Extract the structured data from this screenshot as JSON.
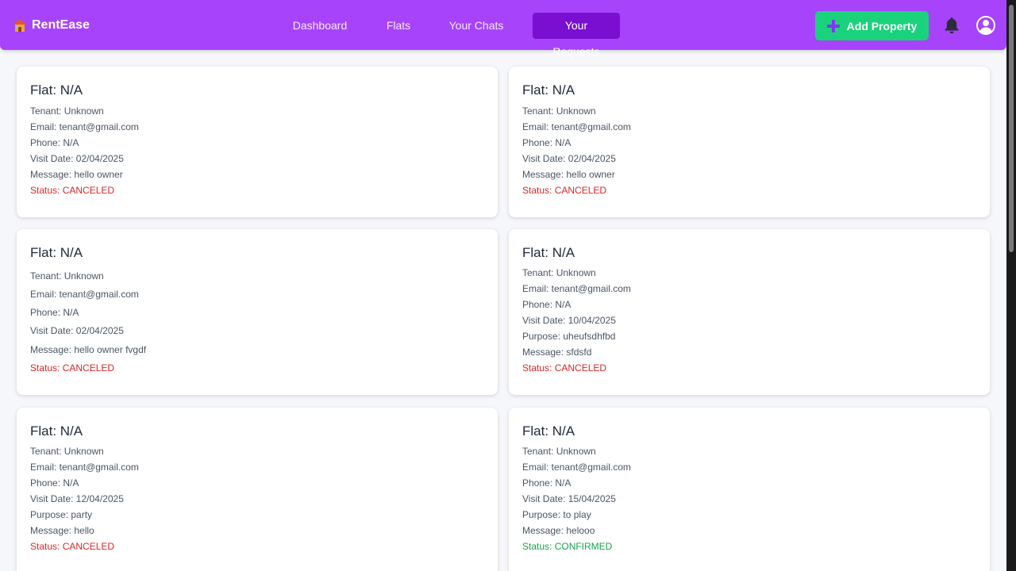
{
  "app": {
    "brand": "RentEase",
    "accent_color": "#a643fb",
    "active_color": "#7a0fd1",
    "add_color": "#1bd27c"
  },
  "nav": {
    "links": [
      {
        "label": "Dashboard"
      },
      {
        "label": "Flats"
      },
      {
        "label": "Your Chats"
      },
      {
        "label": "Your Requests",
        "active": true
      }
    ],
    "add_property_label": "Add Property",
    "icons": [
      "home-icon",
      "plus-icon",
      "bell-icon",
      "user-circle-icon"
    ]
  },
  "requests": [
    {
      "title": "Flat: N/A",
      "tenant": "Tenant: Unknown",
      "email": "Email: tenant@gmail.com",
      "phone": "Phone: N/A",
      "visit_date": "Visit Date: 02/04/2025",
      "message": "Message: hello owner",
      "status": "Status: CANCELED"
    },
    {
      "title": "Flat: N/A",
      "tenant": "Tenant: Unknown",
      "email": "Email: tenant@gmail.com",
      "phone": "Phone: N/A",
      "visit_date": "Visit Date: 02/04/2025",
      "message": "Message: hello owner",
      "status": "Status: CANCELED"
    },
    {
      "title": "Flat: N/A",
      "tenant": "Tenant: Unknown",
      "email": "Email: tenant@gmail.com",
      "phone": "Phone: N/A",
      "visit_date": "Visit Date: 02/04/2025",
      "message": "Message: hello owner fvgdf",
      "status": "Status: CANCELED"
    },
    {
      "title": "Flat: N/A",
      "tenant": "Tenant: Unknown",
      "email": "Email: tenant@gmail.com",
      "phone": "Phone: N/A",
      "visit_date": "Visit Date: 10/04/2025",
      "purpose": "Purpose: uheufsdhfbd",
      "message": "Message: sfdsfd",
      "status": "Status: CANCELED"
    },
    {
      "title": "Flat: N/A",
      "tenant": "Tenant: Unknown",
      "email": "Email: tenant@gmail.com",
      "phone": "Phone: N/A",
      "visit_date": "Visit Date: 12/04/2025",
      "purpose": "Purpose: party",
      "message": "Message: hello",
      "status": "Status: CANCELED"
    },
    {
      "title": "Flat: N/A",
      "tenant": "Tenant: Unknown",
      "email": "Email: tenant@gmail.com",
      "phone": "Phone: N/A",
      "visit_date": "Visit Date: 15/04/2025",
      "purpose": "Purpose: to play",
      "message": "Message: helooo",
      "status": "Status: CONFIRMED"
    }
  ]
}
